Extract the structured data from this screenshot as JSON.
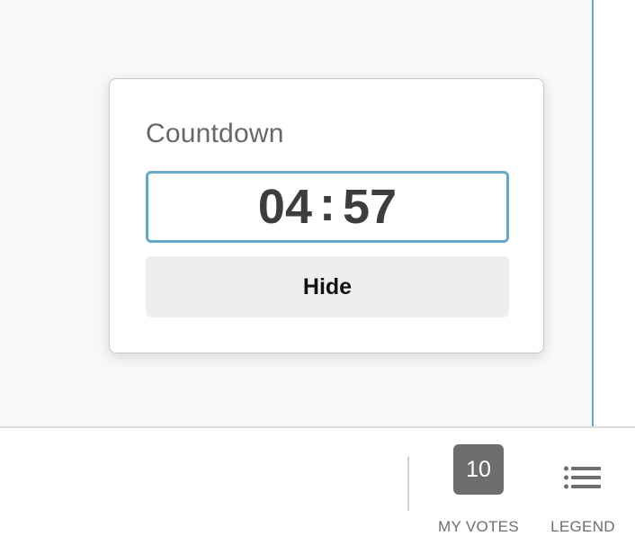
{
  "countdown": {
    "title": "Countdown",
    "minutes": "04",
    "separator": ":",
    "seconds": "57",
    "hide_label": "Hide"
  },
  "bottom_bar": {
    "votes_count": "10",
    "votes_label": "MY VOTES",
    "legend_label": "LEGEND",
    "legend_icon": "list-icon"
  },
  "colors": {
    "accent": "#67a9cc",
    "panel_edge": "#5aa5d4",
    "badge": "#6e6e6e",
    "button_bg": "#eeeeee",
    "canvas_bg": "#f8f8f8"
  }
}
